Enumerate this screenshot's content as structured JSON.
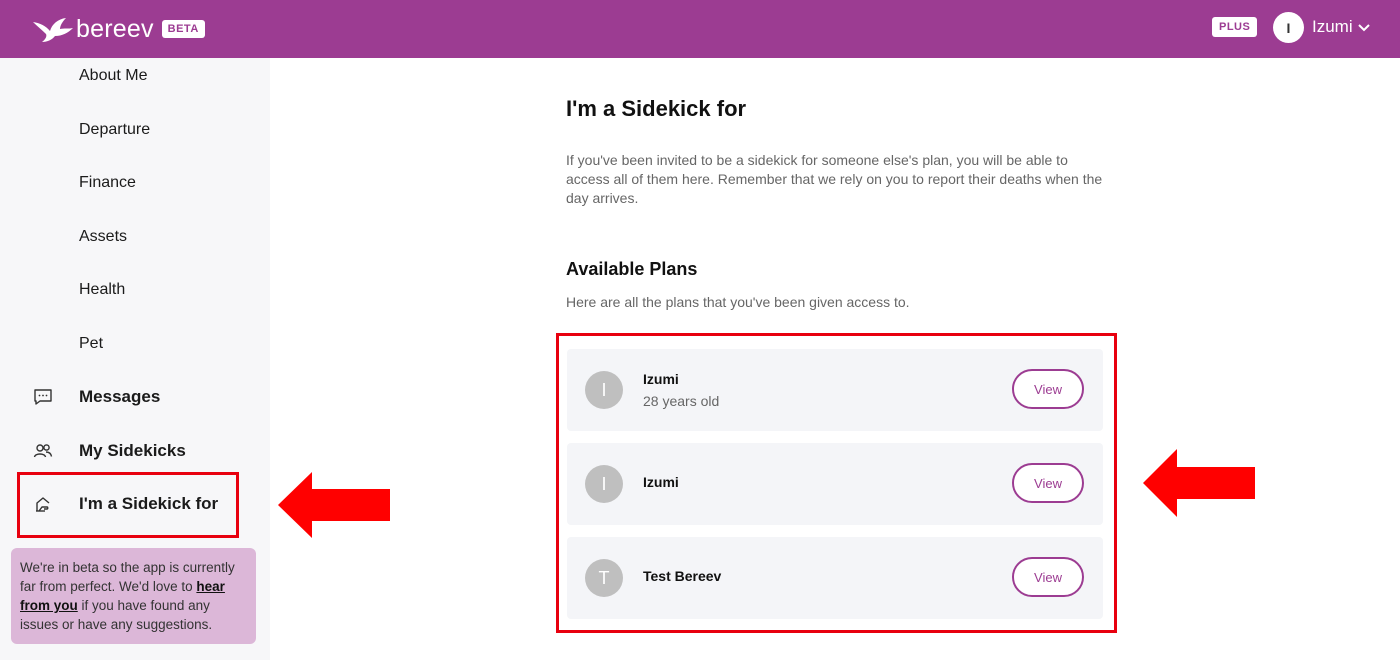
{
  "header": {
    "logo_text": "bereev",
    "beta_label": "BETA",
    "plus_label": "PLUS",
    "user_initial": "I",
    "user_name": "Izumi",
    "brand_color": "#9c3c92"
  },
  "sidebar": {
    "items": [
      {
        "label": "About Me"
      },
      {
        "label": "Departure"
      },
      {
        "label": "Finance"
      },
      {
        "label": "Assets"
      },
      {
        "label": "Health"
      },
      {
        "label": "Pet"
      },
      {
        "label": "Messages",
        "icon": "chat-bubble-icon"
      },
      {
        "label": "My Sidekicks",
        "icon": "people-icon"
      },
      {
        "label": "I'm a Sidekick for",
        "icon": "hand-home-icon"
      }
    ],
    "beta_note": {
      "text_before": "We're in beta so the app is currently far from perfect. We'd love to ",
      "link_text": "hear from you",
      "text_after": " if you have found any issues or have any suggestions."
    }
  },
  "main": {
    "title": "I'm a Sidekick for",
    "description": "If you've been invited to be a sidekick for someone else's plan, you will be able to access all of them here. Remember that we rely on you to report their deaths when the day arrives.",
    "plans_title": "Available Plans",
    "plans_description": "Here are all the plans that you've been given access to.",
    "plans": [
      {
        "initial": "I",
        "name": "Izumi",
        "age": "28 years old",
        "button": "View"
      },
      {
        "initial": "I",
        "name": "Izumi",
        "age": "",
        "button": "View"
      },
      {
        "initial": "T",
        "name": "Test Bereev",
        "age": "",
        "button": "View"
      }
    ]
  },
  "annotation_color": "#e8000f"
}
